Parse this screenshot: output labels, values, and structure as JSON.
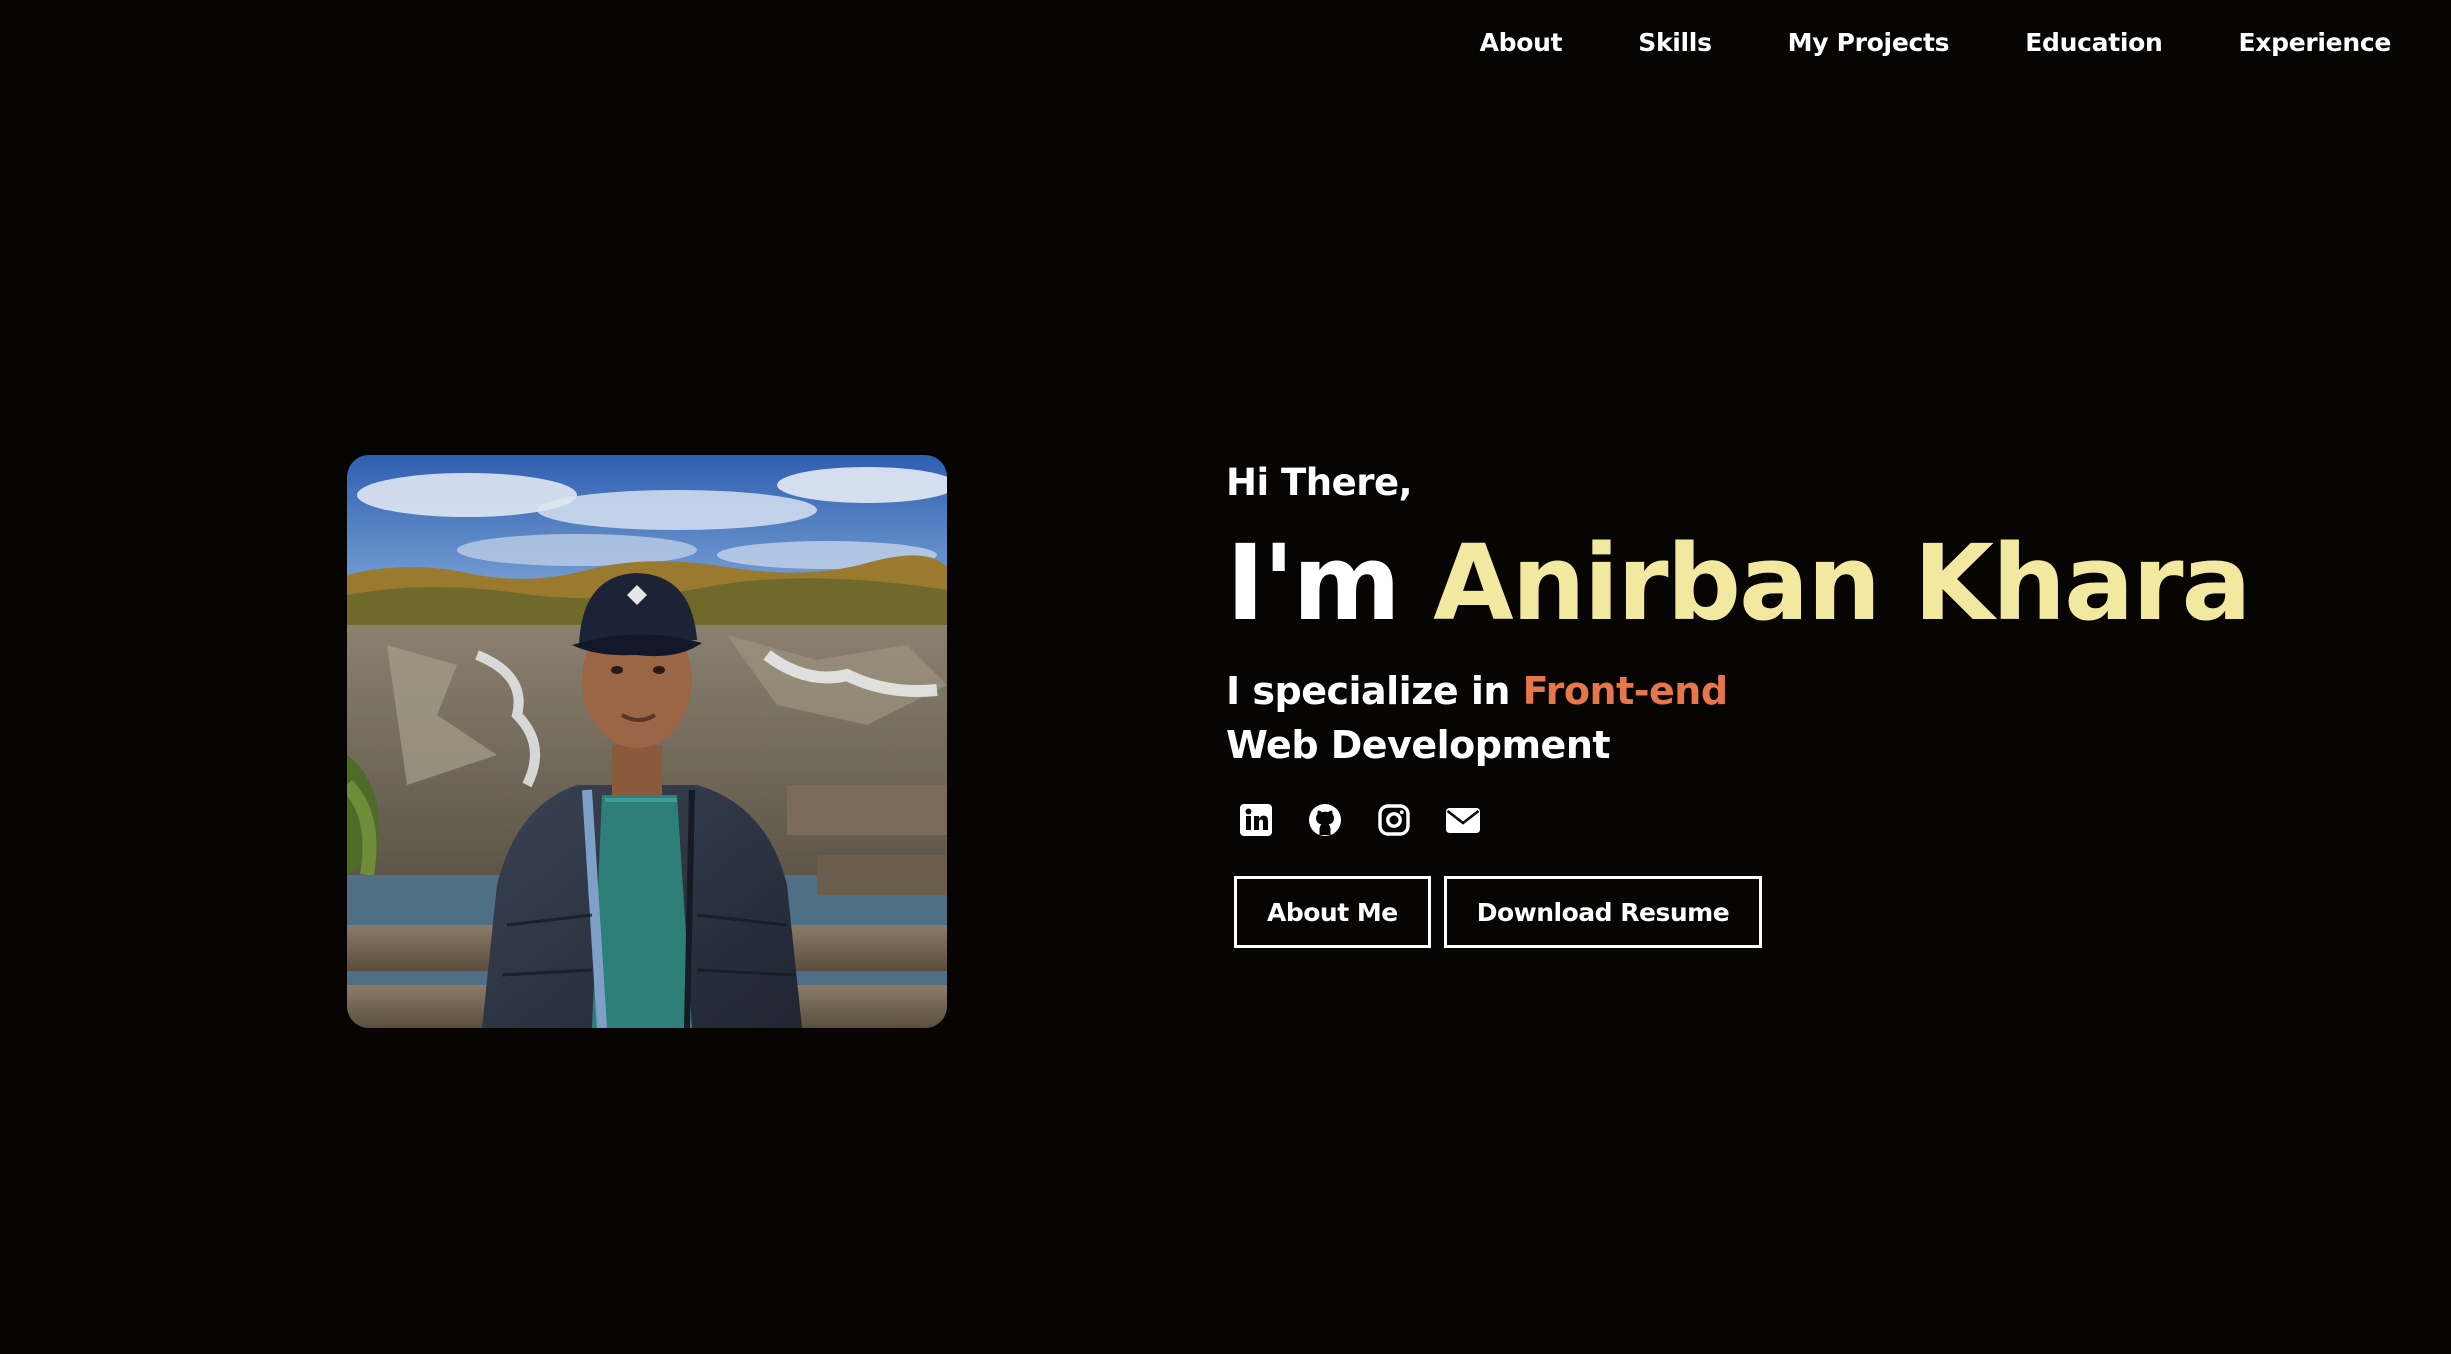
{
  "nav": {
    "items": [
      {
        "label": "About"
      },
      {
        "label": "Skills"
      },
      {
        "label": "My Projects"
      },
      {
        "label": "Education"
      },
      {
        "label": "Experience"
      }
    ]
  },
  "hero": {
    "greeting": "Hi There,",
    "intro": "I'm ",
    "name": "Anirban Khara",
    "specialize_prefix": "I specialize in ",
    "specialize_accent": "Front-end",
    "specialize_suffix": "Web Development",
    "photo_alt": "Profile photo"
  },
  "socials": [
    {
      "icon": "linkedin-icon"
    },
    {
      "icon": "github-icon"
    },
    {
      "icon": "instagram-icon"
    },
    {
      "icon": "envelope-icon"
    }
  ],
  "buttons": {
    "about": "About Me",
    "resume": "Download Resume"
  },
  "colors": {
    "background": "#060504",
    "name_accent": "#f3e8a0",
    "specialty_accent": "#e8764b",
    "text": "#ffffff"
  }
}
